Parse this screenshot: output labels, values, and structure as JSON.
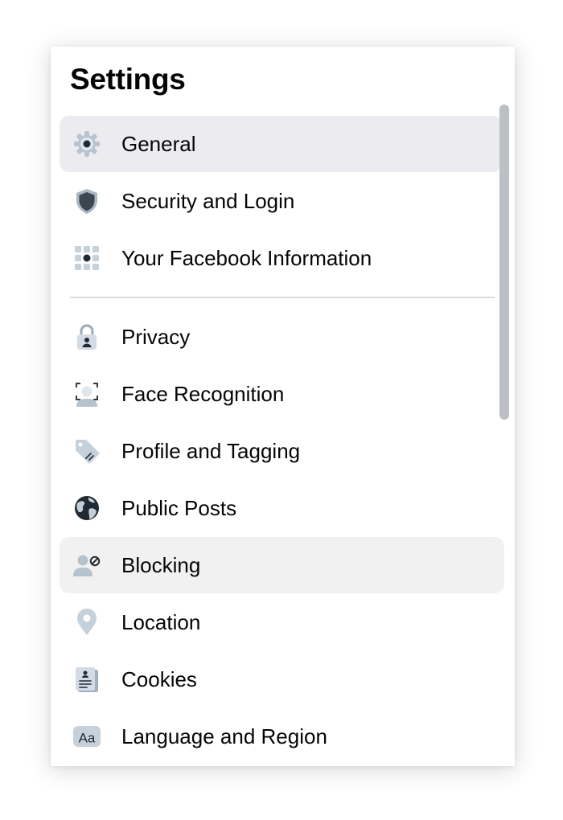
{
  "header": {
    "title": "Settings"
  },
  "items": [
    {
      "label": "General",
      "icon": "gear-icon"
    },
    {
      "label": "Security and Login",
      "icon": "shield-icon"
    },
    {
      "label": "Your Facebook Information",
      "icon": "grid-dots-icon"
    },
    {
      "label": "Privacy",
      "icon": "padlock-icon"
    },
    {
      "label": "Face Recognition",
      "icon": "face-scan-icon"
    },
    {
      "label": "Profile and Tagging",
      "icon": "tag-icon"
    },
    {
      "label": "Public Posts",
      "icon": "globe-icon"
    },
    {
      "label": "Blocking",
      "icon": "user-block-icon"
    },
    {
      "label": "Location",
      "icon": "location-pin-icon"
    },
    {
      "label": "Cookies",
      "icon": "cookie-document-icon"
    },
    {
      "label": "Language and Region",
      "icon": "language-aa-icon"
    }
  ],
  "state": {
    "selected": "General",
    "hovered": "Blocking"
  },
  "colors": {
    "icon_light": "#c5d0da",
    "icon_mid": "#8fa3b3",
    "icon_dark": "#2e3a44",
    "selected_bg": "#ececf0",
    "hover_bg": "#f1f1f1",
    "text": "#050505"
  }
}
